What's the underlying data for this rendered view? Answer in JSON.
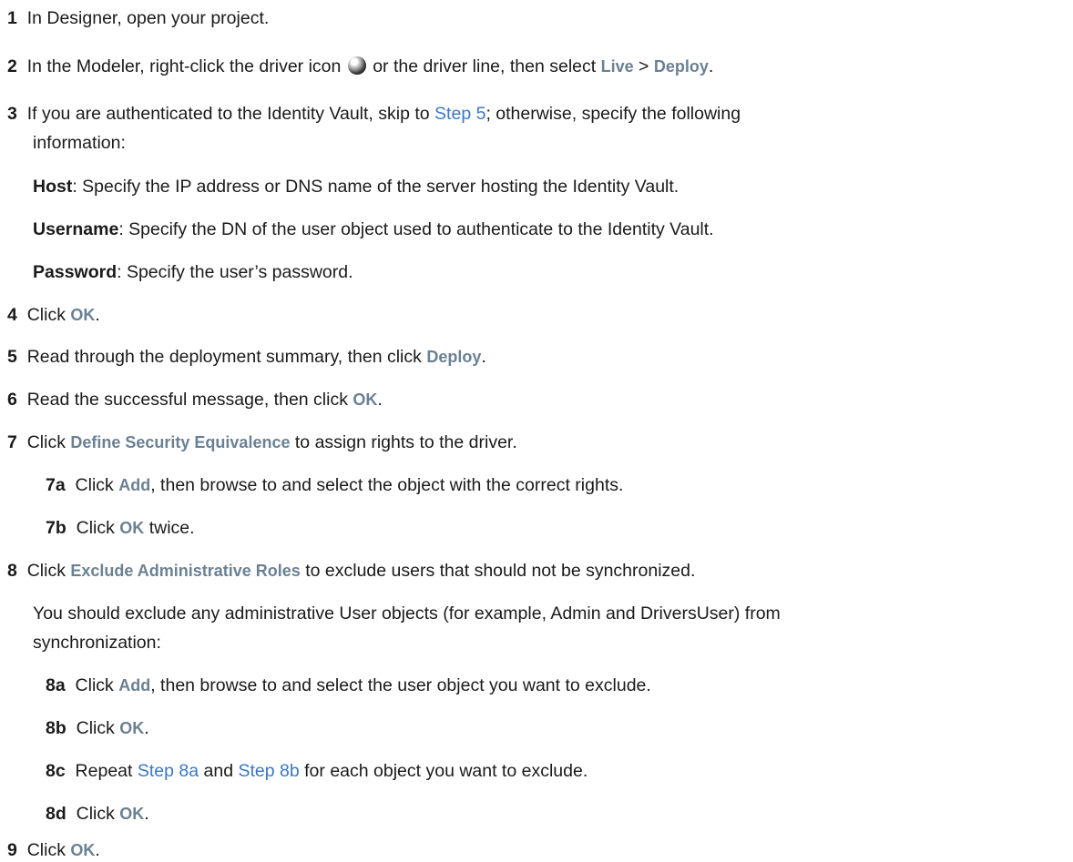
{
  "steps": [
    {
      "num": "1",
      "text": "In Designer, open your project."
    },
    {
      "num": "2",
      "a": "In the Modeler, right-click the driver icon",
      "b": "or the driver line, then select",
      "ui1": "Live",
      "sep": ">",
      "ui2": "Deploy",
      "end": "."
    },
    {
      "num": "3",
      "a": "If you are authenticated to the Identity Vault, skip to",
      "link": "Step 5",
      "b": "; otherwise, specify the following",
      "c": "information:"
    },
    {
      "host_label": "Host",
      "host_text": ": Specify the IP address or DNS name of the server hosting the Identity Vault.",
      "user_label": "Username",
      "user_text": ": Specify the DN of the user object used to authenticate to the Identity Vault.",
      "pass_label": "Password",
      "pass_text": ": Specify the user’s password."
    },
    {
      "num": "4",
      "a": "Click",
      "ui": "OK",
      "end": "."
    },
    {
      "num": "5",
      "a": "Read through the deployment summary, then click",
      "ui": "Deploy",
      "end": "."
    },
    {
      "num": "6",
      "a": "Read the successful message, then click",
      "ui": "OK",
      "end": "."
    },
    {
      "num": "7",
      "a": "Click",
      "ui": "Define Security Equivalence",
      "b": "to assign rights to the driver."
    },
    {
      "num": "7a",
      "a": "Click",
      "ui": "Add",
      "b": ", then browse to and select the object with the correct rights."
    },
    {
      "num": "7b",
      "a": "Click",
      "ui": "OK",
      "b": "twice."
    },
    {
      "num": "8",
      "a": "Click",
      "ui": "Exclude Administrative Roles",
      "b": "to exclude users that should not be synchronized."
    },
    {
      "para1": "You should exclude any administrative User objects (for example, Admin and DriversUser) from",
      "para2": "synchronization:"
    },
    {
      "num": "8a",
      "a": "Click",
      "ui": "Add",
      "b": ", then browse to and select the user object you want to exclude."
    },
    {
      "num": "8b",
      "a": "Click",
      "ui": "OK",
      "end": "."
    },
    {
      "num": "8c",
      "a": "Repeat",
      "link1": "Step 8a",
      "and": "and",
      "link2": "Step 8b",
      "b": "for each object you want to exclude."
    },
    {
      "num": "8d",
      "a": "Click",
      "ui": "OK",
      "end": "."
    },
    {
      "num": "9",
      "a": "Click",
      "ui": "OK",
      "end": "."
    }
  ],
  "icons": {
    "driver": "yin-yang-driver-icon"
  }
}
